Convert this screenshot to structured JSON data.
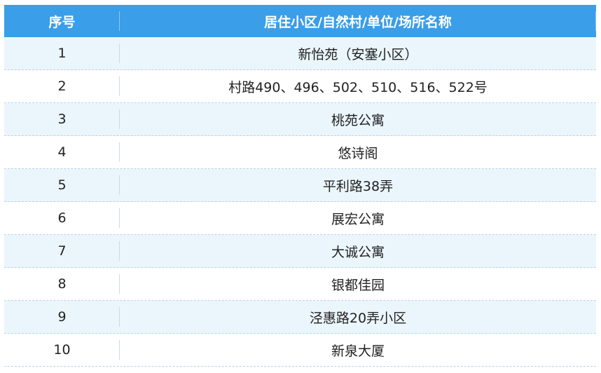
{
  "table": {
    "headers": {
      "index": "序号",
      "name": "居住小区/自然村/单位/场所名称"
    },
    "rows": [
      {
        "index": "1",
        "name": "新怡苑（安塞小区）"
      },
      {
        "index": "2",
        "name": "村路490、496、502、510、516、522号"
      },
      {
        "index": "3",
        "name": "桃苑公寓"
      },
      {
        "index": "4",
        "name": "悠诗阁"
      },
      {
        "index": "5",
        "name": "平利路38弄"
      },
      {
        "index": "6",
        "name": "展宏公寓"
      },
      {
        "index": "7",
        "name": "大诚公寓"
      },
      {
        "index": "8",
        "name": "银都佳园"
      },
      {
        "index": "9",
        "name": "泾惠路20弄小区"
      },
      {
        "index": "10",
        "name": "新泉大厦"
      }
    ]
  },
  "colors": {
    "header_bg": "#3a9ee8",
    "stripe_bg": "#eaf6fc"
  }
}
